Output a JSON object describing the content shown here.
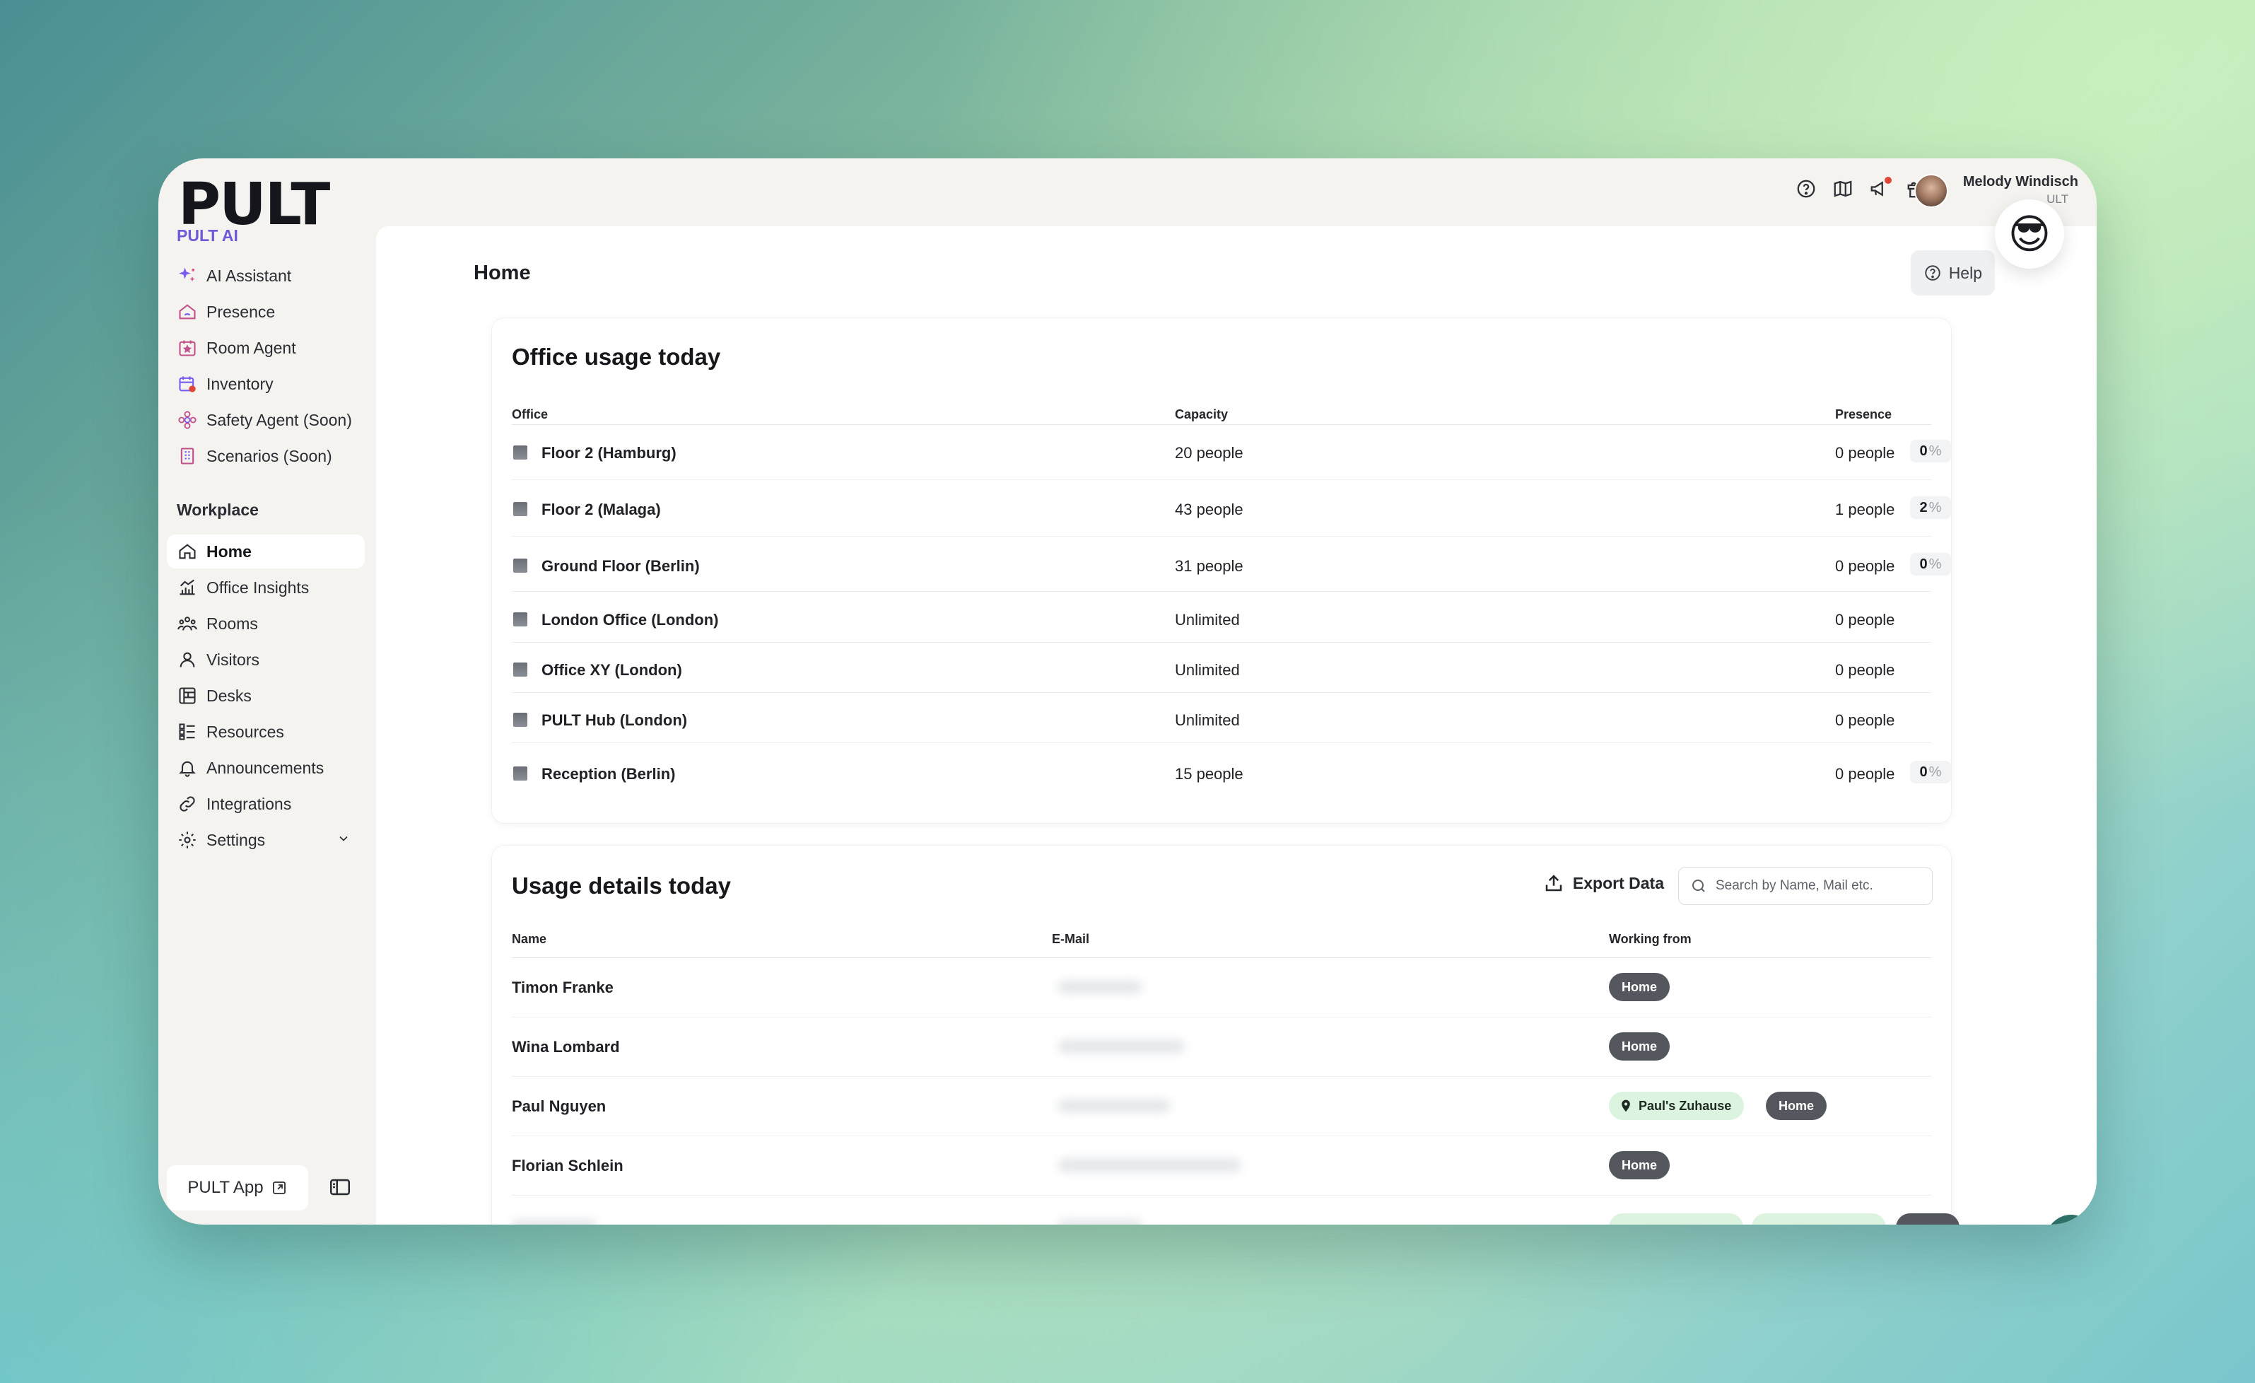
{
  "brand": {
    "logo": "PULT",
    "ai_section": "PULT AI"
  },
  "sidebar": {
    "ai_items": [
      {
        "label": "AI Assistant",
        "icon": "sparkle-icon"
      },
      {
        "label": "Presence",
        "icon": "home-signal-icon"
      },
      {
        "label": "Room Agent",
        "icon": "calendar-star-icon"
      },
      {
        "label": "Inventory",
        "icon": "calendar-check-icon"
      },
      {
        "label": "Safety Agent (Soon)",
        "icon": "flower-icon"
      },
      {
        "label": "Scenarios (Soon)",
        "icon": "building-icon"
      }
    ],
    "workplace_heading": "Workplace",
    "work_items": [
      {
        "label": "Home",
        "icon": "home-icon",
        "active": true
      },
      {
        "label": "Office Insights",
        "icon": "chart-icon"
      },
      {
        "label": "Rooms",
        "icon": "rooms-icon"
      },
      {
        "label": "Visitors",
        "icon": "person-icon"
      },
      {
        "label": "Desks",
        "icon": "desk-icon"
      },
      {
        "label": "Resources",
        "icon": "resources-icon"
      },
      {
        "label": "Announcements",
        "icon": "bell-icon"
      },
      {
        "label": "Integrations",
        "icon": "link-icon"
      },
      {
        "label": "Settings",
        "icon": "gear-icon"
      }
    ],
    "pult_app": "PULT App"
  },
  "topbar": {
    "user_name": "Melody Windisch",
    "user_sub": "ULT",
    "emoji": "😎"
  },
  "page": {
    "title": "Home",
    "help": "Help"
  },
  "office_usage": {
    "title": "Office usage today",
    "headers": {
      "office": "Office",
      "capacity": "Capacity",
      "presence": "Presence"
    },
    "rows": [
      {
        "office": "Floor 2 (Hamburg)",
        "capacity": "20 people",
        "presence": "0 people",
        "pct": "0",
        "pct_unit": "%"
      },
      {
        "office": "Floor 2 (Malaga)",
        "capacity": "43 people",
        "presence": "1 people",
        "pct": "2",
        "pct_unit": "%"
      },
      {
        "office": "Ground Floor (Berlin)",
        "capacity": "31 people",
        "presence": "0 people",
        "pct": "0",
        "pct_unit": "%"
      },
      {
        "office": "London Office (London)",
        "capacity": "Unlimited",
        "presence": "0 people"
      },
      {
        "office": "Office XY (London)",
        "capacity": "Unlimited",
        "presence": "0 people"
      },
      {
        "office": "PULT Hub (London)",
        "capacity": "Unlimited",
        "presence": "0 people"
      },
      {
        "office": "Reception (Berlin)",
        "capacity": "15 people",
        "presence": "0 people",
        "pct": "0",
        "pct_unit": "%"
      }
    ]
  },
  "usage_details": {
    "title": "Usage details today",
    "export": "Export Data",
    "search_placeholder": "Search by Name, Mail etc.",
    "headers": {
      "name": "Name",
      "email": "E-Mail",
      "working_from": "Working from"
    },
    "rows": [
      {
        "name": "Timon Franke",
        "badge": "Home"
      },
      {
        "name": "Wina Lombard",
        "badge": "Home"
      },
      {
        "name": "Paul Nguyen",
        "location": "Paul's Zuhause",
        "badge": "Home"
      },
      {
        "name": "Florian Schlein",
        "badge": "Home"
      }
    ]
  },
  "colors": {
    "accent": "#6f59d8",
    "badge": "#54575e",
    "chat": "#2e6f68"
  }
}
